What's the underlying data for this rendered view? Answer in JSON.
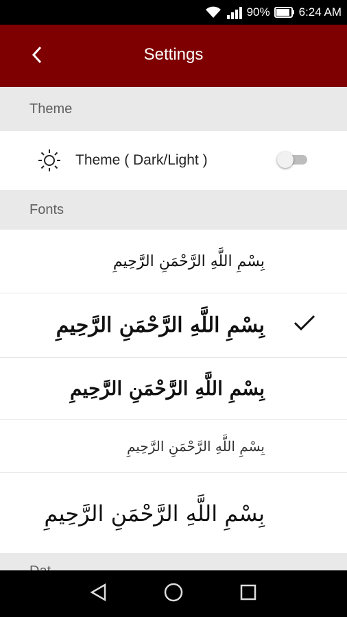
{
  "status_bar": {
    "battery_percent": "90%",
    "time": "6:24 AM",
    "icons": [
      "wifi-icon",
      "signal-icon",
      "battery-icon"
    ]
  },
  "app_bar": {
    "title": "Settings",
    "back_icon": "back-arrow-icon",
    "color": "#7f0000"
  },
  "sections": {
    "theme": {
      "header": "Theme",
      "item_label": "Theme ( Dark/Light )",
      "icon": "sun-icon",
      "toggle_on": false
    },
    "fonts": {
      "header": "Fonts",
      "items": [
        {
          "sample": "بِسْمِ اللَّهِ الرَّحْمَنِ الرَّحِيمِ",
          "selected": false
        },
        {
          "sample": "بِسْمِ اللَّهِ الرَّحْمَنِ الرَّحِيمِ",
          "selected": true
        },
        {
          "sample": "بِسْمِ اللَّهِ الرَّحْمَنِ الرَّحِيمِ",
          "selected": false
        },
        {
          "sample": "بِسْمِ اللَّهِ الرَّحْمَنِ الرَّحِيمِ",
          "selected": false
        },
        {
          "sample": "بِسْمِ اللَّهِ الرَّحْمَنِ الرَّحِيمِ",
          "selected": false
        }
      ]
    },
    "next_header_partial": "Dat"
  },
  "nav_bar": {
    "icons": [
      "back-triangle-icon",
      "home-circle-icon",
      "recents-square-icon"
    ]
  }
}
